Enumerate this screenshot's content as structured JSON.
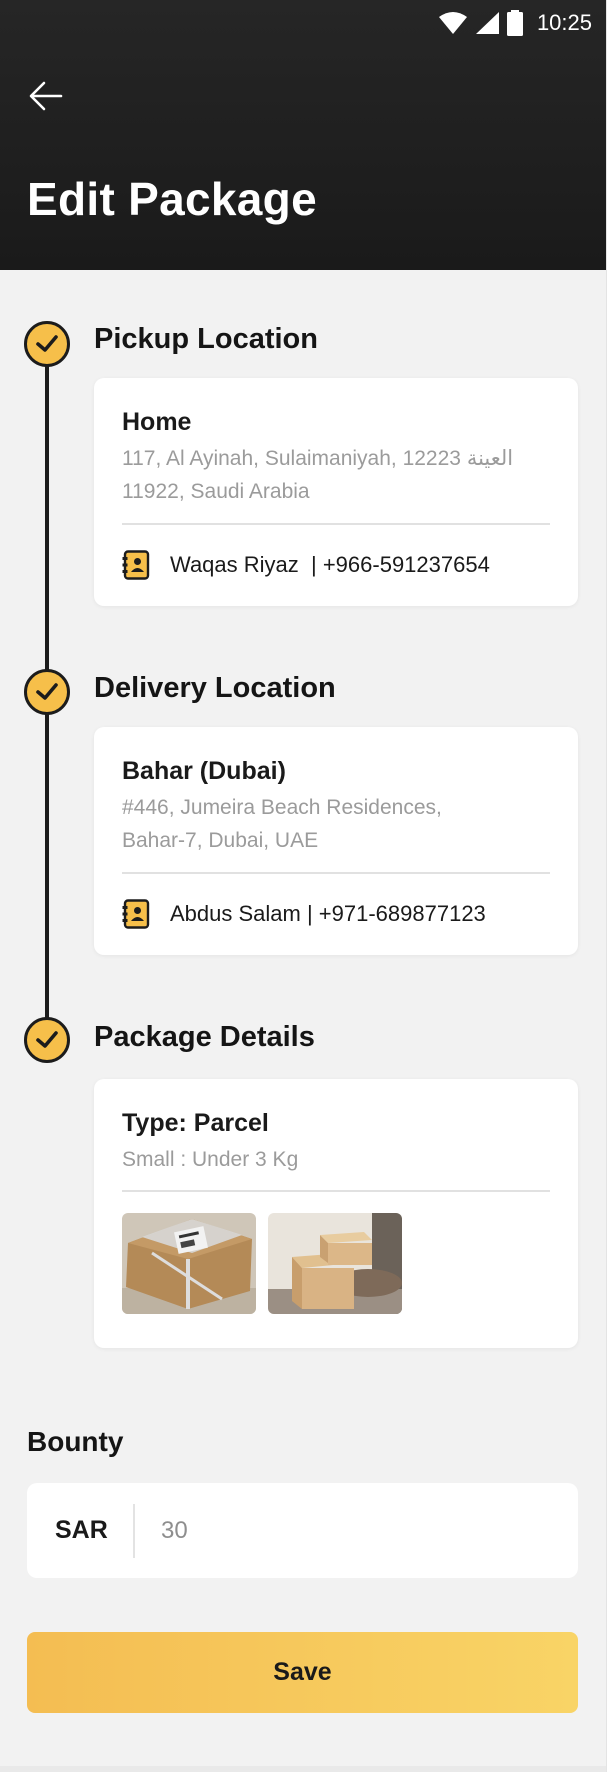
{
  "status_bar": {
    "time": "10:25"
  },
  "header": {
    "title": "Edit Package"
  },
  "pickup": {
    "section_title": "Pickup Location",
    "place_name": "Home",
    "address": "117, Al Ayinah, Sulaimaniyah, 12223 العينة 11922, Saudi Arabia",
    "contact": "Waqas Riyaz  | +966-591237654"
  },
  "delivery": {
    "section_title": "Delivery Location",
    "place_name": "Bahar (Dubai)",
    "address": "#446, Jumeira Beach Residences, Bahar-7, Dubai, UAE",
    "contact": "Abdus Salam | +971-689877123"
  },
  "package": {
    "section_title": "Package Details",
    "type": "Type: Parcel",
    "size": "Small : Under 3 Kg"
  },
  "bounty": {
    "label": "Bounty",
    "currency": "SAR",
    "value": "30"
  },
  "save_label": "Save",
  "colors": {
    "accent": "#f6bf4a",
    "header_bg": "#1f1f1f",
    "page_bg": "#f2f2f2",
    "card_bg": "#ffffff",
    "muted_text": "#9b9b9b"
  },
  "icons": {
    "back": "arrow-left-icon",
    "check": "check-circle-icon",
    "contact": "contact-book-icon"
  }
}
